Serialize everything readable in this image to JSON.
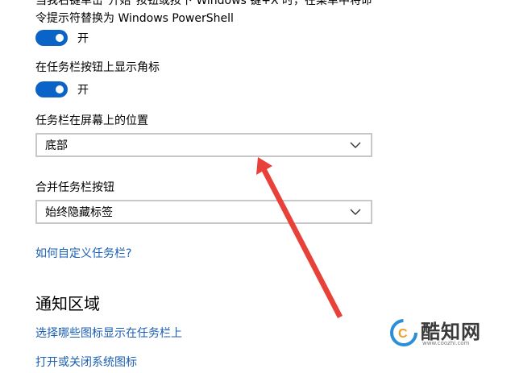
{
  "settings": {
    "powershell_desc_line1": "当我右键单击\"开始\"按钮或按下 Windows 键+X 时，在菜单中将命",
    "powershell_desc_line2": "令提示符替换为 Windows PowerShell",
    "powershell_toggle_state": "开",
    "badge_label": "在任务栏按钮上显示角标",
    "badge_toggle_state": "开",
    "position_label": "任务栏在屏幕上的位置",
    "position_value": "底部",
    "combine_label": "合并任务栏按钮",
    "combine_value": "始终隐藏标签",
    "customize_link": "如何自定义任务栏?"
  },
  "notification": {
    "title": "通知区域",
    "select_icons_link": "选择哪些图标显示在任务栏上",
    "system_icons_link": "打开或关闭系统图标"
  },
  "watermark": {
    "name": "酷知网",
    "url": "www.coozhi.com"
  },
  "colors": {
    "toggle_on": "#0a64c8",
    "link": "#1a5fb4",
    "arrow": "#e8413a",
    "border": "#c8c8c8"
  }
}
